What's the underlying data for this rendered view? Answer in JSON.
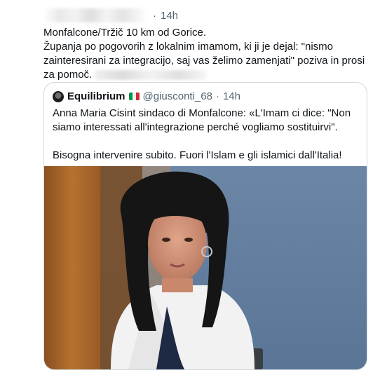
{
  "tweet": {
    "author_name": "",
    "dot": "·",
    "time": "14h",
    "text_line1": "Monfalcone/Tržič 10 km od Gorice.",
    "text_line2": "Županja po pogovorih z lokalnim imamom, ki ji je dejal: \"nismo zainteresirani za integracijo, saj vas želimo zamenjati\" poziva in prosi za pomoč."
  },
  "quote": {
    "author_name": "Equilibrium",
    "flag_icon": "italy-flag-icon",
    "handle": "@giusconti_68",
    "dot": "·",
    "time": "14h",
    "text_p1": "Anna Maria Cisint sindaco di Monfalcone: «L'Imam ci dice: \"Non siamo interessati all'integrazione perché vogliamo sostituirvi\".",
    "text_p2": "Bisogna intervenire subito. Fuori l'Islam e gli islamici dall'Italia!"
  },
  "colors": {
    "text": "#0f1419",
    "secondary": "#536471",
    "border": "#cfd9de"
  }
}
